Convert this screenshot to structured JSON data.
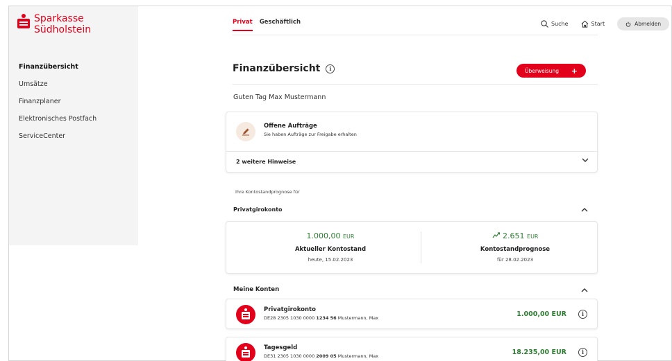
{
  "brand": {
    "line1": "Sparkasse",
    "line2": "Südholstein",
    "color": "#e2001a"
  },
  "sidebar": {
    "items": [
      {
        "label": "Finanzübersicht",
        "active": true
      },
      {
        "label": "Umsätze"
      },
      {
        "label": "Finanzplaner"
      },
      {
        "label": "Elektronisches Postfach"
      },
      {
        "label": "ServiceCenter"
      }
    ]
  },
  "tabs": [
    {
      "label": "Privat",
      "active": true
    },
    {
      "label": "Geschäftlich"
    }
  ],
  "top_actions": {
    "search": "Suche",
    "home": "Start",
    "logout": "Abmelden"
  },
  "main": {
    "title": "Finanzübersicht",
    "transfer_button": "Überweisung",
    "greeting": "Guten Tag Max Mustermann"
  },
  "orders": {
    "title": "Offene Aufträge",
    "subtitle": "Sie haben Aufträge zur Freigabe erhalten",
    "hints": "2 weitere Hinweise"
  },
  "forecast": {
    "label": "Ihre Kontostandprognose für",
    "account": "Privatgirokonto",
    "current_amount": "1.000,00",
    "current_currency": "EUR",
    "current_label": "Aktueller Kontostand",
    "current_date": "heute, 15.02.2023",
    "forecast_amount": "2.651",
    "forecast_currency": "EUR",
    "forecast_label": "Kontostandprognose",
    "forecast_date": "für 28.02.2023"
  },
  "accounts": {
    "heading": "Meine Konten",
    "items": [
      {
        "name": "Privatgirokonto",
        "iban_pre": "DE28 2305 1030 0000",
        "iban_bold": "1234 56",
        "owner": "Mustermann, Max",
        "balance": "1.000,00 EUR"
      },
      {
        "name": "Tagesgeld",
        "iban_pre": "DE31 2305 1030 0000",
        "iban_bold": "2009 05",
        "owner": "Mustermann, Max",
        "balance": "18.235,00 EUR"
      }
    ]
  },
  "colors": {
    "accent": "#e2001a",
    "positive": "#2e7d32"
  },
  "icons": [
    "search-icon",
    "home-icon",
    "power-icon",
    "info-icon",
    "plus-icon",
    "pen-icon",
    "chevron-down-icon",
    "chevron-up-icon",
    "trend-up-icon",
    "sparkasse-logo-icon"
  ]
}
